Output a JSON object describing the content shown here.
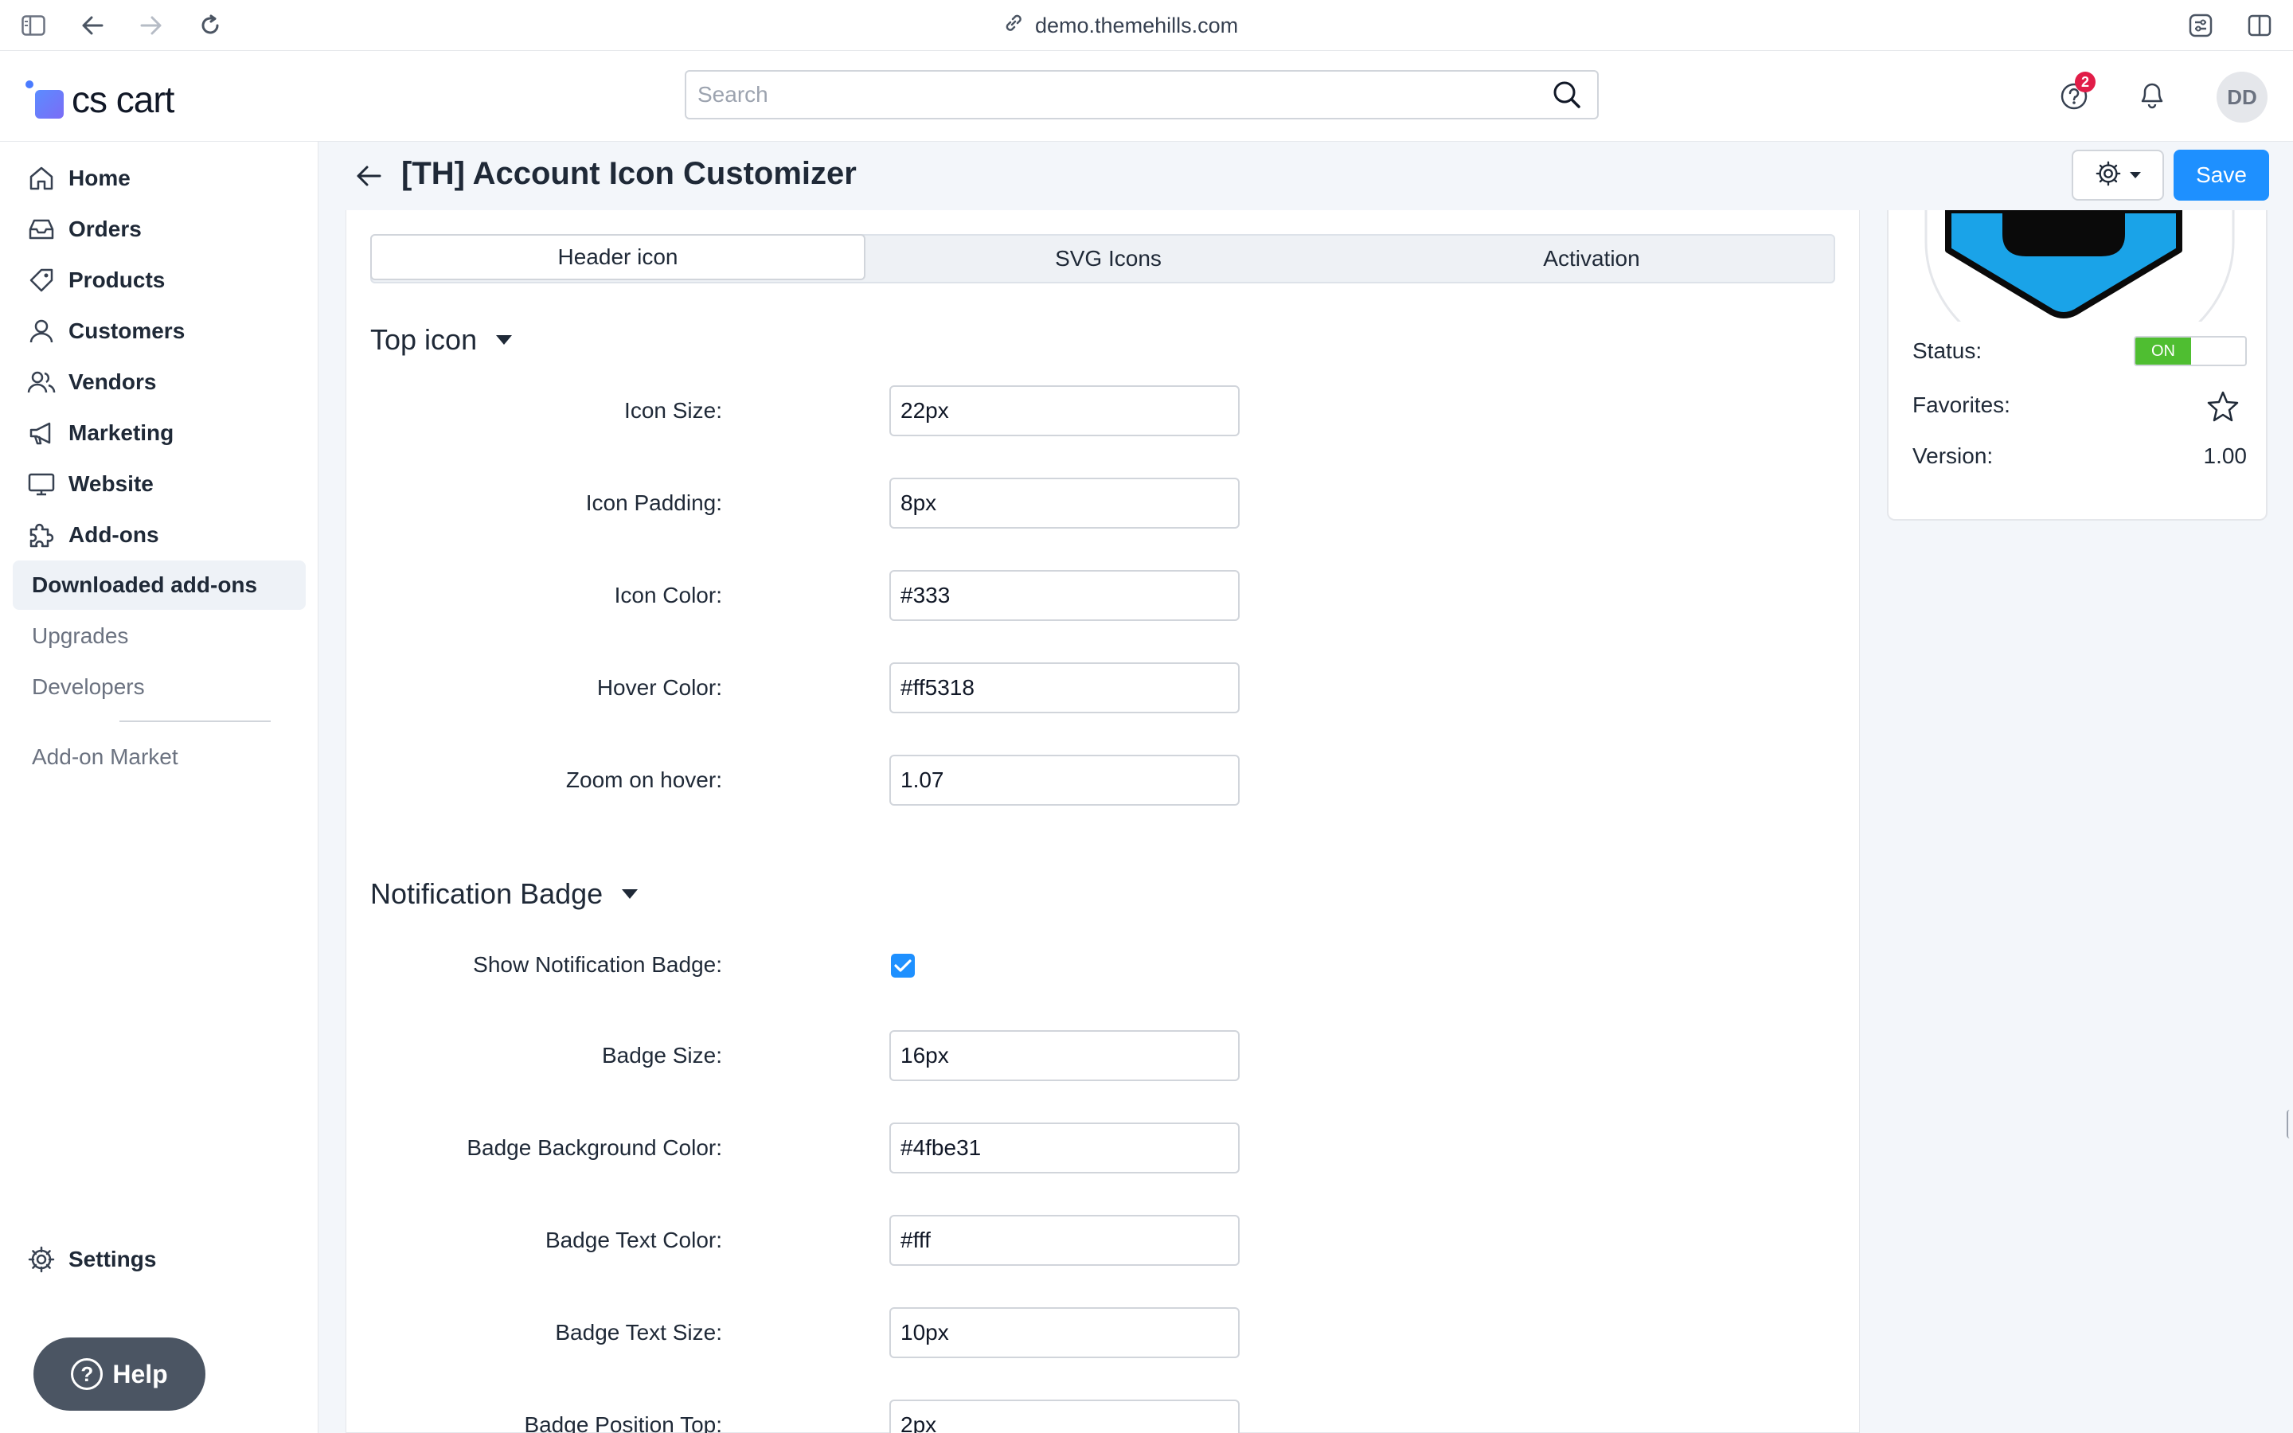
{
  "browser": {
    "url": "demo.themehills.com"
  },
  "header": {
    "logo_text": "cs cart",
    "search_placeholder": "Search",
    "notification_count": "2",
    "user_initials": "DD"
  },
  "sidebar": {
    "items": [
      {
        "label": "Home",
        "icon": "home-icon"
      },
      {
        "label": "Orders",
        "icon": "inbox-icon"
      },
      {
        "label": "Products",
        "icon": "tag-icon"
      },
      {
        "label": "Customers",
        "icon": "user-icon"
      },
      {
        "label": "Vendors",
        "icon": "users-icon"
      },
      {
        "label": "Marketing",
        "icon": "megaphone-icon"
      },
      {
        "label": "Website",
        "icon": "monitor-icon"
      },
      {
        "label": "Add-ons",
        "icon": "puzzle-icon"
      }
    ],
    "subitems": [
      {
        "label": "Downloaded add-ons",
        "active": true
      },
      {
        "label": "Upgrades"
      },
      {
        "label": "Developers"
      },
      {
        "label": "Add-on Market"
      }
    ],
    "settings_label": "Settings",
    "help_label": "Help"
  },
  "page": {
    "title": "[TH] Account Icon Customizer",
    "save_label": "Save",
    "tabs": [
      {
        "label": "Header icon",
        "active": true
      },
      {
        "label": "SVG Icons"
      },
      {
        "label": "Activation"
      }
    ]
  },
  "top_icon": {
    "heading": "Top icon",
    "fields": [
      {
        "label": "Icon Size:",
        "value": "22px"
      },
      {
        "label": "Icon Padding:",
        "value": "8px"
      },
      {
        "label": "Icon Color:",
        "value": "#333"
      },
      {
        "label": "Hover Color:",
        "value": "#ff5318"
      },
      {
        "label": "Zoom on hover:",
        "value": "1.07"
      }
    ]
  },
  "notification_badge": {
    "heading": "Notification Badge",
    "show_label": "Show Notification Badge:",
    "show_checked": true,
    "fields": [
      {
        "label": "Badge Size:",
        "value": "16px"
      },
      {
        "label": "Badge Background Color:",
        "value": "#4fbe31"
      },
      {
        "label": "Badge Text Color:",
        "value": "#fff"
      },
      {
        "label": "Badge Text Size:",
        "value": "10px"
      },
      {
        "label": "Badge Position Top:",
        "value": "2px"
      }
    ]
  },
  "addon_info": {
    "status_label": "Status:",
    "status_value": "ON",
    "favorites_label": "Favorites:",
    "version_label": "Version:",
    "version_value": "1.00"
  },
  "colors": {
    "primary": "#1e90ff",
    "status_on": "#4fbe31",
    "notification": "#e11d48"
  }
}
